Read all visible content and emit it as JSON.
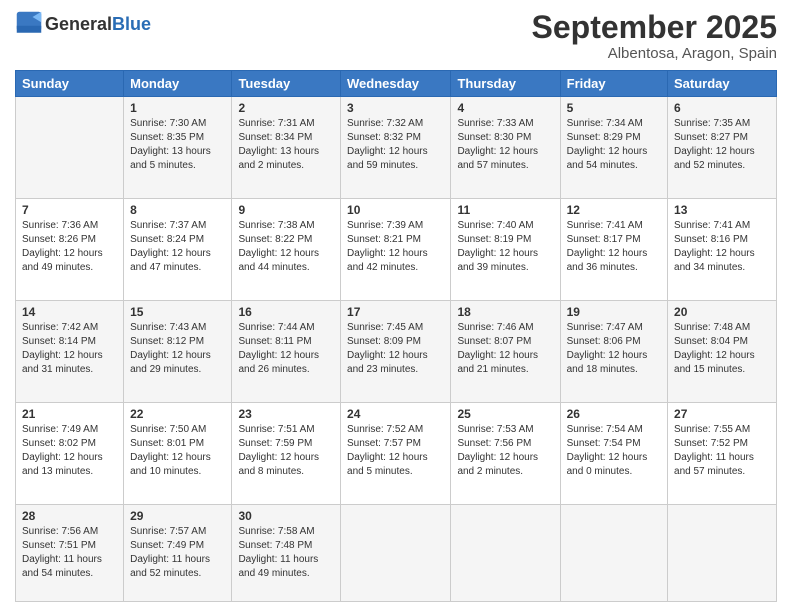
{
  "logo": {
    "general": "General",
    "blue": "Blue"
  },
  "header": {
    "month": "September 2025",
    "location": "Albentosa, Aragon, Spain"
  },
  "weekdays": [
    "Sunday",
    "Monday",
    "Tuesday",
    "Wednesday",
    "Thursday",
    "Friday",
    "Saturday"
  ],
  "weeks": [
    [
      {
        "day": "",
        "info": ""
      },
      {
        "day": "1",
        "info": "Sunrise: 7:30 AM\nSunset: 8:35 PM\nDaylight: 13 hours\nand 5 minutes."
      },
      {
        "day": "2",
        "info": "Sunrise: 7:31 AM\nSunset: 8:34 PM\nDaylight: 13 hours\nand 2 minutes."
      },
      {
        "day": "3",
        "info": "Sunrise: 7:32 AM\nSunset: 8:32 PM\nDaylight: 12 hours\nand 59 minutes."
      },
      {
        "day": "4",
        "info": "Sunrise: 7:33 AM\nSunset: 8:30 PM\nDaylight: 12 hours\nand 57 minutes."
      },
      {
        "day": "5",
        "info": "Sunrise: 7:34 AM\nSunset: 8:29 PM\nDaylight: 12 hours\nand 54 minutes."
      },
      {
        "day": "6",
        "info": "Sunrise: 7:35 AM\nSunset: 8:27 PM\nDaylight: 12 hours\nand 52 minutes."
      }
    ],
    [
      {
        "day": "7",
        "info": "Sunrise: 7:36 AM\nSunset: 8:26 PM\nDaylight: 12 hours\nand 49 minutes."
      },
      {
        "day": "8",
        "info": "Sunrise: 7:37 AM\nSunset: 8:24 PM\nDaylight: 12 hours\nand 47 minutes."
      },
      {
        "day": "9",
        "info": "Sunrise: 7:38 AM\nSunset: 8:22 PM\nDaylight: 12 hours\nand 44 minutes."
      },
      {
        "day": "10",
        "info": "Sunrise: 7:39 AM\nSunset: 8:21 PM\nDaylight: 12 hours\nand 42 minutes."
      },
      {
        "day": "11",
        "info": "Sunrise: 7:40 AM\nSunset: 8:19 PM\nDaylight: 12 hours\nand 39 minutes."
      },
      {
        "day": "12",
        "info": "Sunrise: 7:41 AM\nSunset: 8:17 PM\nDaylight: 12 hours\nand 36 minutes."
      },
      {
        "day": "13",
        "info": "Sunrise: 7:41 AM\nSunset: 8:16 PM\nDaylight: 12 hours\nand 34 minutes."
      }
    ],
    [
      {
        "day": "14",
        "info": "Sunrise: 7:42 AM\nSunset: 8:14 PM\nDaylight: 12 hours\nand 31 minutes."
      },
      {
        "day": "15",
        "info": "Sunrise: 7:43 AM\nSunset: 8:12 PM\nDaylight: 12 hours\nand 29 minutes."
      },
      {
        "day": "16",
        "info": "Sunrise: 7:44 AM\nSunset: 8:11 PM\nDaylight: 12 hours\nand 26 minutes."
      },
      {
        "day": "17",
        "info": "Sunrise: 7:45 AM\nSunset: 8:09 PM\nDaylight: 12 hours\nand 23 minutes."
      },
      {
        "day": "18",
        "info": "Sunrise: 7:46 AM\nSunset: 8:07 PM\nDaylight: 12 hours\nand 21 minutes."
      },
      {
        "day": "19",
        "info": "Sunrise: 7:47 AM\nSunset: 8:06 PM\nDaylight: 12 hours\nand 18 minutes."
      },
      {
        "day": "20",
        "info": "Sunrise: 7:48 AM\nSunset: 8:04 PM\nDaylight: 12 hours\nand 15 minutes."
      }
    ],
    [
      {
        "day": "21",
        "info": "Sunrise: 7:49 AM\nSunset: 8:02 PM\nDaylight: 12 hours\nand 13 minutes."
      },
      {
        "day": "22",
        "info": "Sunrise: 7:50 AM\nSunset: 8:01 PM\nDaylight: 12 hours\nand 10 minutes."
      },
      {
        "day": "23",
        "info": "Sunrise: 7:51 AM\nSunset: 7:59 PM\nDaylight: 12 hours\nand 8 minutes."
      },
      {
        "day": "24",
        "info": "Sunrise: 7:52 AM\nSunset: 7:57 PM\nDaylight: 12 hours\nand 5 minutes."
      },
      {
        "day": "25",
        "info": "Sunrise: 7:53 AM\nSunset: 7:56 PM\nDaylight: 12 hours\nand 2 minutes."
      },
      {
        "day": "26",
        "info": "Sunrise: 7:54 AM\nSunset: 7:54 PM\nDaylight: 12 hours\nand 0 minutes."
      },
      {
        "day": "27",
        "info": "Sunrise: 7:55 AM\nSunset: 7:52 PM\nDaylight: 11 hours\nand 57 minutes."
      }
    ],
    [
      {
        "day": "28",
        "info": "Sunrise: 7:56 AM\nSunset: 7:51 PM\nDaylight: 11 hours\nand 54 minutes."
      },
      {
        "day": "29",
        "info": "Sunrise: 7:57 AM\nSunset: 7:49 PM\nDaylight: 11 hours\nand 52 minutes."
      },
      {
        "day": "30",
        "info": "Sunrise: 7:58 AM\nSunset: 7:48 PM\nDaylight: 11 hours\nand 49 minutes."
      },
      {
        "day": "",
        "info": ""
      },
      {
        "day": "",
        "info": ""
      },
      {
        "day": "",
        "info": ""
      },
      {
        "day": "",
        "info": ""
      }
    ]
  ]
}
